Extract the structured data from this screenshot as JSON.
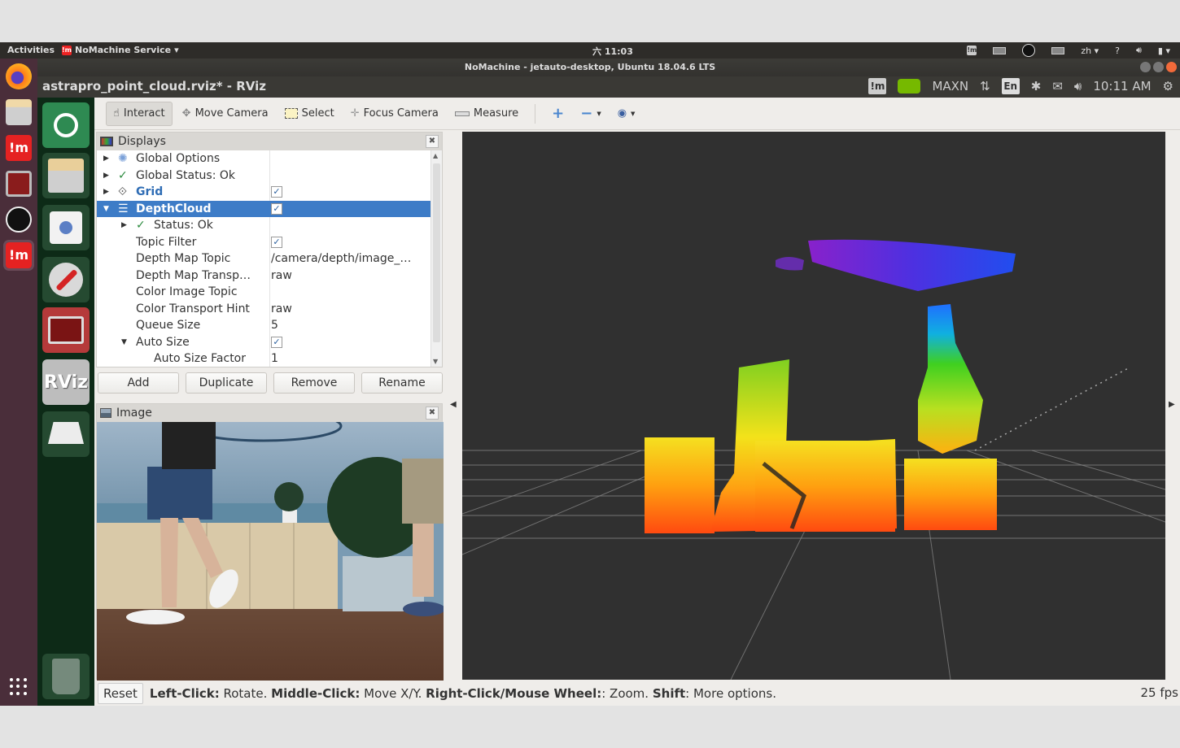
{
  "host_bar": {
    "activities": "Activities",
    "app_menu": "NoMachine Service",
    "clock": "六 11:03",
    "tray_lang": "zh",
    "tray_help": "?"
  },
  "host_window": {
    "title": "NoMachine - jetauto-desktop, Ubuntu 18.04.6 LTS"
  },
  "remote_panel": {
    "app_title": "astrapro_point_cloud.rviz* - RViz",
    "power_mode": "MAXN",
    "input_method": "En",
    "time": "10:11 AM"
  },
  "host_dock": {
    "items": [
      {
        "name": "firefox"
      },
      {
        "name": "files"
      },
      {
        "name": "nomachine"
      },
      {
        "name": "remote-desktop"
      },
      {
        "name": "obs"
      },
      {
        "name": "nomachine-active"
      }
    ],
    "app_grid": "show-applications"
  },
  "remote_dock": {
    "items": [
      {
        "name": "ubuntu-home"
      },
      {
        "name": "files"
      },
      {
        "name": "software-center"
      },
      {
        "name": "system-settings"
      },
      {
        "name": "remote-desktop"
      },
      {
        "name": "rviz",
        "label": "RViz"
      },
      {
        "name": "drive"
      },
      {
        "name": "trash"
      }
    ]
  },
  "toolbar": {
    "tools": [
      {
        "label": "Interact",
        "icon": "hand-icon",
        "active": true
      },
      {
        "label": "Move Camera",
        "icon": "move-icon",
        "active": false
      },
      {
        "label": "Select",
        "icon": "select-icon",
        "active": false
      },
      {
        "label": "Focus Camera",
        "icon": "focus-icon",
        "active": false
      },
      {
        "label": "Measure",
        "icon": "ruler-icon",
        "active": false
      }
    ]
  },
  "displays": {
    "title": "Displays",
    "rows": [
      {
        "label": "Global Options",
        "icon": "gear-icon",
        "expander": "collapsed",
        "indent": 0,
        "value": "",
        "checked": null
      },
      {
        "label": "Global Status: Ok",
        "icon": "check-icon",
        "expander": "collapsed",
        "indent": 0,
        "value": "",
        "checked": null
      },
      {
        "label": "Grid",
        "icon": "grid-icon",
        "expander": "collapsed",
        "indent": 0,
        "value": "",
        "checked": true
      },
      {
        "label": "DepthCloud",
        "icon": "depthcloud-icon",
        "expander": "expanded",
        "indent": 0,
        "value": "",
        "checked": true,
        "selected": true
      },
      {
        "label": "Status: Ok",
        "icon": "check-icon",
        "expander": "collapsed",
        "indent": 1,
        "value": "",
        "checked": null
      },
      {
        "label": "Topic Filter",
        "indent": 1,
        "value": "",
        "checked": true
      },
      {
        "label": "Depth Map Topic",
        "indent": 1,
        "value": "/camera/depth/image_…",
        "checked": null
      },
      {
        "label": "Depth Map Transp…",
        "indent": 1,
        "value": "raw",
        "checked": null
      },
      {
        "label": "Color Image Topic",
        "indent": 1,
        "value": "",
        "checked": null
      },
      {
        "label": "Color Transport Hint",
        "indent": 1,
        "value": "raw",
        "checked": null
      },
      {
        "label": "Queue Size",
        "indent": 1,
        "value": "5",
        "checked": null
      },
      {
        "label": "Auto Size",
        "expander": "expanded",
        "indent": 1,
        "value": "",
        "checked": true
      },
      {
        "label": "Auto Size Factor",
        "indent": 2,
        "value": "1",
        "checked": null
      }
    ],
    "buttons": {
      "add": "Add",
      "duplicate": "Duplicate",
      "remove": "Remove",
      "rename": "Rename"
    }
  },
  "image_panel": {
    "title": "Image"
  },
  "statusbar": {
    "reset": "Reset",
    "hint_parts": [
      {
        "bold": "Left-Click:",
        "text": " Rotate. "
      },
      {
        "bold": "Middle-Click:",
        "text": " Move X/Y. "
      },
      {
        "bold": "Right-Click/Mouse Wheel:",
        "text": ": Zoom. "
      },
      {
        "bold": "Shift",
        "text": ": More options."
      }
    ],
    "fps": "25 fps"
  },
  "colors": {
    "selection": "#3d7cc7",
    "grid_label": "#2f6db5",
    "view_bg": "#303030",
    "accent_close": "#f26a3a"
  }
}
